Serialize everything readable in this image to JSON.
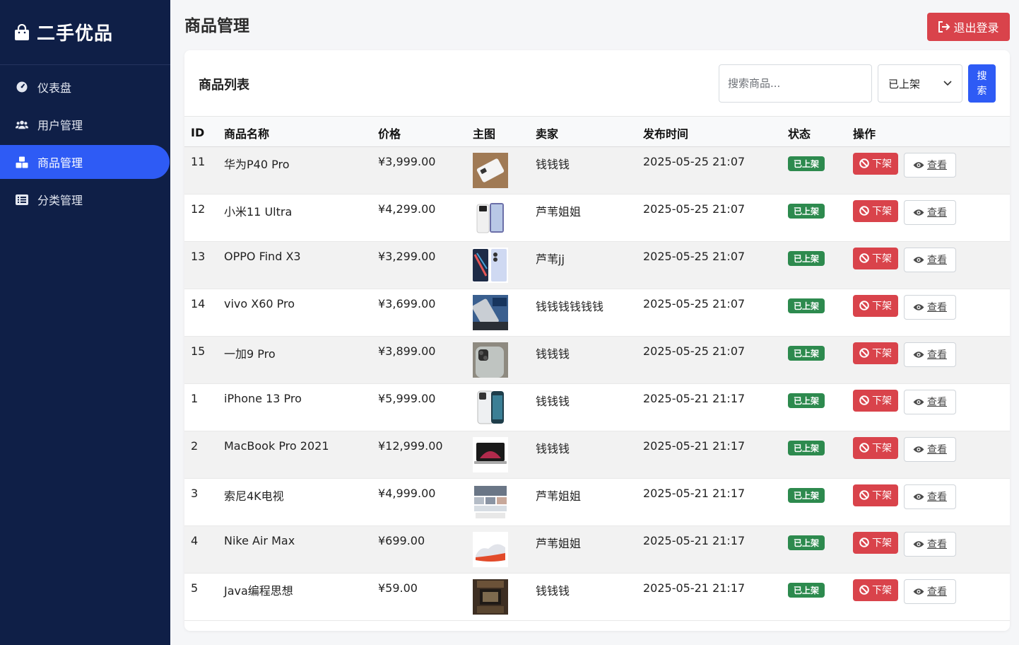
{
  "brand": {
    "title": "二手优品"
  },
  "nav": [
    {
      "label": "仪表盘",
      "icon": "dashboard-icon",
      "active": false
    },
    {
      "label": "用户管理",
      "icon": "users-icon",
      "active": false
    },
    {
      "label": "商品管理",
      "icon": "boxes-icon",
      "active": true
    },
    {
      "label": "分类管理",
      "icon": "list-icon",
      "active": false
    }
  ],
  "header": {
    "title": "商品管理",
    "logout_label": "退出登录"
  },
  "card": {
    "title": "商品列表",
    "search_placeholder": "搜索商品...",
    "status_selected": "已上架",
    "search_label": "搜索"
  },
  "table": {
    "columns": [
      "ID",
      "商品名称",
      "价格",
      "主图",
      "卖家",
      "发布时间",
      "状态",
      "操作"
    ],
    "off_label": "下架",
    "view_label": "查看",
    "rows": [
      {
        "id": "11",
        "name": "华为P40 Pro",
        "price": "¥3,999.00",
        "seller": "钱钱钱",
        "time": "2025-05-25 21:07",
        "status": "已上架"
      },
      {
        "id": "12",
        "name": "小米11 Ultra",
        "price": "¥4,299.00",
        "seller": "芦苇姐姐",
        "time": "2025-05-25 21:07",
        "status": "已上架"
      },
      {
        "id": "13",
        "name": "OPPO Find X3",
        "price": "¥3,299.00",
        "seller": "芦苇jj",
        "time": "2025-05-25 21:07",
        "status": "已上架"
      },
      {
        "id": "14",
        "name": "vivo X60 Pro",
        "price": "¥3,699.00",
        "seller": "钱钱钱钱钱钱",
        "time": "2025-05-25 21:07",
        "status": "已上架"
      },
      {
        "id": "15",
        "name": "一加9 Pro",
        "price": "¥3,899.00",
        "seller": "钱钱钱",
        "time": "2025-05-25 21:07",
        "status": "已上架"
      },
      {
        "id": "1",
        "name": "iPhone 13 Pro",
        "price": "¥5,999.00",
        "seller": "钱钱钱",
        "time": "2025-05-21 21:17",
        "status": "已上架"
      },
      {
        "id": "2",
        "name": "MacBook Pro 2021",
        "price": "¥12,999.00",
        "seller": "钱钱钱",
        "time": "2025-05-21 21:17",
        "status": "已上架"
      },
      {
        "id": "3",
        "name": "索尼4K电视",
        "price": "¥4,999.00",
        "seller": "芦苇姐姐",
        "time": "2025-05-21 21:17",
        "status": "已上架"
      },
      {
        "id": "4",
        "name": "Nike Air Max",
        "price": "¥699.00",
        "seller": "芦苇姐姐",
        "time": "2025-05-21 21:17",
        "status": "已上架"
      },
      {
        "id": "5",
        "name": "Java编程思想",
        "price": "¥59.00",
        "seller": "钱钱钱",
        "time": "2025-05-21 21:17",
        "status": "已上架"
      }
    ]
  },
  "colors": {
    "sidebar": "#0f1f47",
    "accent": "#2e5bf5",
    "danger": "#d9434b",
    "success": "#2d8a4e"
  }
}
